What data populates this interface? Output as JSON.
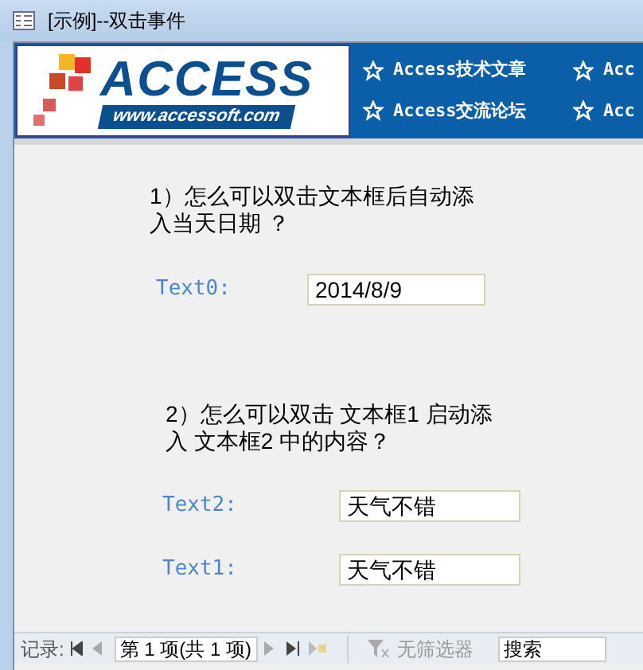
{
  "window": {
    "title": "[示例]--双击事件"
  },
  "banner": {
    "logo_title": "ACCESS",
    "logo_url": "www.accessoft.com",
    "links": [
      {
        "label": "Access技术文章"
      },
      {
        "label": "Acc"
      },
      {
        "label": "Access交流论坛"
      },
      {
        "label": "Acc"
      }
    ]
  },
  "form": {
    "sections": [
      {
        "question": "1）怎么可以双击文本框后自动添入当天日期 ？",
        "fields": [
          {
            "label": "Text0:",
            "value": "2014/8/9"
          }
        ]
      },
      {
        "question": "2）怎么可以双击 文本框1 启动添入 文本框2 中的内容？",
        "fields": [
          {
            "label": "Text2:",
            "value": "天气不错"
          },
          {
            "label": "Text1:",
            "value": "天气不错"
          }
        ]
      }
    ]
  },
  "record_nav": {
    "label": "记录:",
    "position": "第 1 项(共 1 项)",
    "filter": "无筛选器",
    "search_placeholder": "搜索"
  }
}
